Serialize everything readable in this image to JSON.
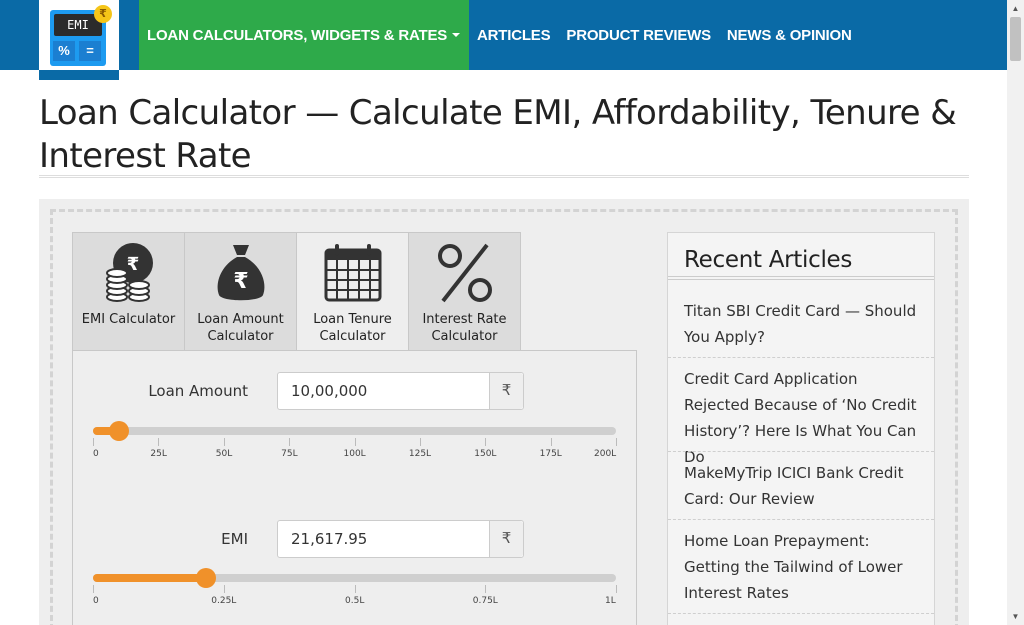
{
  "header": {
    "logo": {
      "screen_text": "EMI",
      "key_percent": "%",
      "key_equals": "=",
      "coin_symbol": "₹"
    },
    "nav": [
      {
        "label": "LOAN CALCULATORS, WIDGETS & RATES"
      },
      {
        "label": "ARTICLES"
      },
      {
        "label": "PRODUCT REVIEWS"
      },
      {
        "label": "NEWS & OPINION"
      }
    ]
  },
  "page_title": "Loan Calculator — Calculate EMI, Affordability, Tenure & Interest Rate",
  "tabs": [
    {
      "label": "EMI Calculator",
      "icon": "coins-icon",
      "active": false
    },
    {
      "label": "Loan Amount Calculator",
      "icon": "money-bag-icon",
      "active": false
    },
    {
      "label": "Loan Tenure Calculator",
      "icon": "calendar-icon",
      "active": true
    },
    {
      "label": "Interest Rate Calculator",
      "icon": "percent-icon",
      "active": false
    }
  ],
  "form": {
    "loan_amount": {
      "label": "Loan Amount",
      "value": "10,00,000",
      "currency": "₹",
      "slider_fraction": 0.05,
      "ticks": [
        "0",
        "25L",
        "50L",
        "75L",
        "100L",
        "125L",
        "150L",
        "175L",
        "200L"
      ]
    },
    "emi": {
      "label": "EMI",
      "value": "21,617.95",
      "currency": "₹",
      "slider_fraction": 0.216,
      "ticks": [
        "0",
        "0.25L",
        "0.5L",
        "0.75L",
        "1L"
      ]
    }
  },
  "sidebar": {
    "title": "Recent Articles",
    "articles": [
      {
        "title": "Titan SBI Credit Card — Should You Apply?"
      },
      {
        "title": "Credit Card Application Rejected Because of ‘No Credit History’? Here Is What You Can Do"
      },
      {
        "title": "MakeMyTrip ICICI Bank Credit Card: Our Review"
      },
      {
        "title": "Home Loan Prepayment: Getting the Tailwind of Lower Interest Rates"
      }
    ]
  },
  "colors": {
    "header_blue": "#0a6aa6",
    "nav_green": "#2eaa4a",
    "slider_orange": "#f0912a"
  }
}
